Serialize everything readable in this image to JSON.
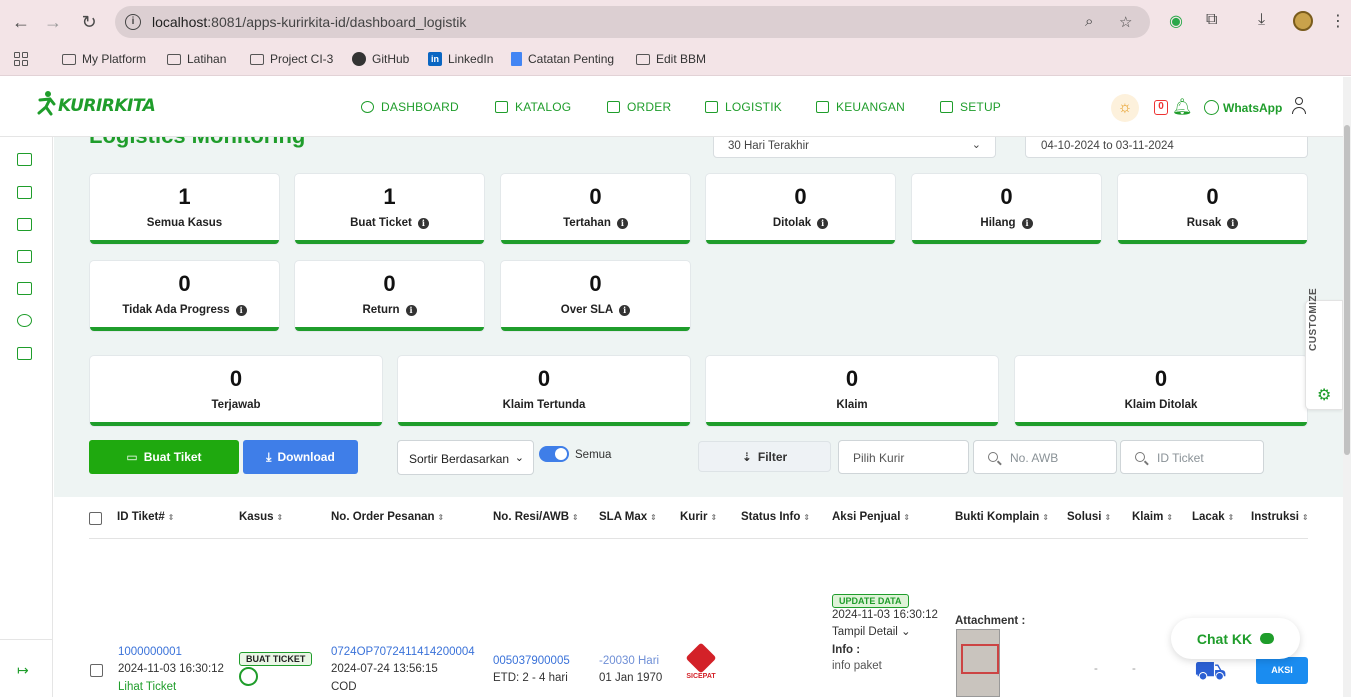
{
  "browser": {
    "url_host": "localhost",
    "url_rest": ":8081/apps-kurirkita-id/dashboard_logistik",
    "bookmarks": [
      "My Platform",
      "Latihan",
      "Project CI-3",
      "GitHub",
      "LinkedIn",
      "Catatan Penting",
      "Edit BBM"
    ]
  },
  "header": {
    "logo": "KURIRKITA",
    "menu": [
      "DASHBOARD",
      "KATALOG",
      "ORDER",
      "LOGISTIK",
      "KEUANGAN",
      "SETUP"
    ],
    "notif_count": "0",
    "whatsapp": "WhatsApp"
  },
  "page": {
    "title": "Logistics Monitoring",
    "range_select": "30 Hari Terakhir",
    "date_range": "04-10-2024 to 03-11-2024"
  },
  "cards_row1": [
    {
      "value": "1",
      "label": "Semua Kasus",
      "info": false
    },
    {
      "value": "1",
      "label": "Buat Ticket",
      "info": true
    },
    {
      "value": "0",
      "label": "Tertahan",
      "info": true
    },
    {
      "value": "0",
      "label": "Ditolak",
      "info": true
    },
    {
      "value": "0",
      "label": "Hilang",
      "info": true
    },
    {
      "value": "0",
      "label": "Rusak",
      "info": true
    }
  ],
  "cards_row2": [
    {
      "value": "0",
      "label": "Tidak Ada Progress",
      "info": true
    },
    {
      "value": "0",
      "label": "Return",
      "info": true
    },
    {
      "value": "0",
      "label": "Over SLA",
      "info": true
    }
  ],
  "cards_row3": [
    {
      "value": "0",
      "label": "Terjawab"
    },
    {
      "value": "0",
      "label": "Klaim Tertunda"
    },
    {
      "value": "0",
      "label": "Klaim"
    },
    {
      "value": "0",
      "label": "Klaim Ditolak"
    }
  ],
  "toolbar": {
    "buat_tiket": "Buat Tiket",
    "download": "Download",
    "sort": "Sortir Berdasarkan",
    "toggle_label": "Semua",
    "filter": "Filter",
    "kurir_placeholder": "Pilih Kurir",
    "awb_placeholder": "No. AWB",
    "ticket_placeholder": "ID Ticket"
  },
  "table": {
    "headers": [
      "ID Tiket#",
      "Kasus",
      "No. Order Pesanan",
      "No. Resi/AWB",
      "SLA Max",
      "Kurir",
      "Status Info",
      "Aksi Penjual",
      "Bukti Komplain",
      "Solusi",
      "Klaim",
      "Lacak",
      "Instruksi"
    ],
    "row": {
      "id": "1000000001",
      "id_date": "2024-11-03 16:30:12",
      "lihat": "Lihat Ticket",
      "kasus_tag": "BUAT TICKET",
      "order_no": "0724OP7072411414200004",
      "order_date": "2024-07-24 13:56:15",
      "order_type": "COD",
      "resi": "005037900005",
      "etd": "ETD: 2 - 4 hari",
      "sla": "-20030 Hari",
      "sla_date": "01 Jan 1970",
      "kurir": "SICEPAT",
      "aksi_tag": "UPDATE DATA",
      "aksi_date": "2024-11-03 16:30:12",
      "tampil": "Tampil Detail",
      "info_label": "Info :",
      "info_value": "info paket",
      "attachment": "Attachment :",
      "solusi": "-",
      "klaim": "-",
      "aksi_btn": "AKSI"
    }
  },
  "floating": {
    "customize": "CUSTOMIZE",
    "chat": "Chat KK"
  }
}
